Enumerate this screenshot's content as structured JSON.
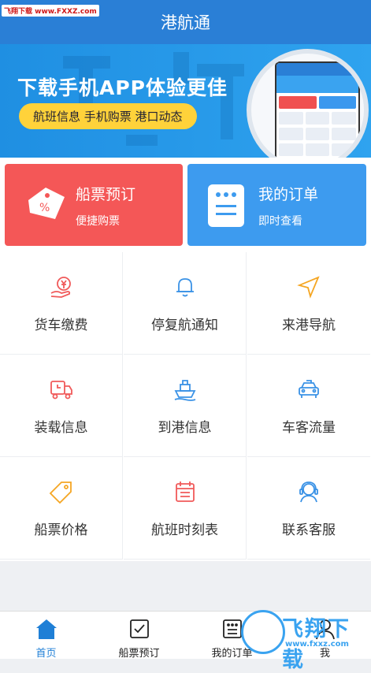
{
  "watermark_top": "飞翔下载 www.FXXZ.com",
  "header": {
    "title": "港航通"
  },
  "banner": {
    "headline": "下载手机APP体验更佳",
    "pill": "航班信息  手机购票  港口动态"
  },
  "cards": [
    {
      "title": "船票预订",
      "subtitle": "便捷购票",
      "icon": "ticket-icon"
    },
    {
      "title": "我的订单",
      "subtitle": "即时查看",
      "icon": "order-list-icon"
    }
  ],
  "grid": [
    {
      "label": "货车缴费",
      "icon": "yen-hand-icon",
      "color": "#f05a5a"
    },
    {
      "label": "停复航通知",
      "icon": "bell-icon",
      "color": "#3a92e6"
    },
    {
      "label": "来港导航",
      "icon": "navigation-arrow-icon",
      "color": "#f5a623"
    },
    {
      "label": "装载信息",
      "icon": "truck-clock-icon",
      "color": "#f05a5a"
    },
    {
      "label": "到港信息",
      "icon": "ship-icon",
      "color": "#3a92e6"
    },
    {
      "label": "车客流量",
      "icon": "taxi-icon",
      "color": "#3a92e6"
    },
    {
      "label": "船票价格",
      "icon": "price-tag-icon",
      "color": "#f5a623"
    },
    {
      "label": "航班时刻表",
      "icon": "calendar-icon",
      "color": "#f05a5a"
    },
    {
      "label": "联系客服",
      "icon": "headset-icon",
      "color": "#3a92e6"
    }
  ],
  "tabbar": [
    {
      "label": "首页",
      "icon": "home-icon",
      "active": true
    },
    {
      "label": "船票预订",
      "icon": "checkbox-icon",
      "active": false
    },
    {
      "label": "我的订单",
      "icon": "order-icon",
      "active": false
    },
    {
      "label": "我",
      "icon": "user-icon",
      "active": false
    }
  ],
  "watermark_bottom": {
    "brand": "飞翔下载",
    "url": "www.fxxz.com"
  },
  "colors": {
    "primary": "#2a7fd6",
    "card_red": "#f45757",
    "card_blue": "#3d9bef",
    "banner_pill": "#ffd23a"
  }
}
